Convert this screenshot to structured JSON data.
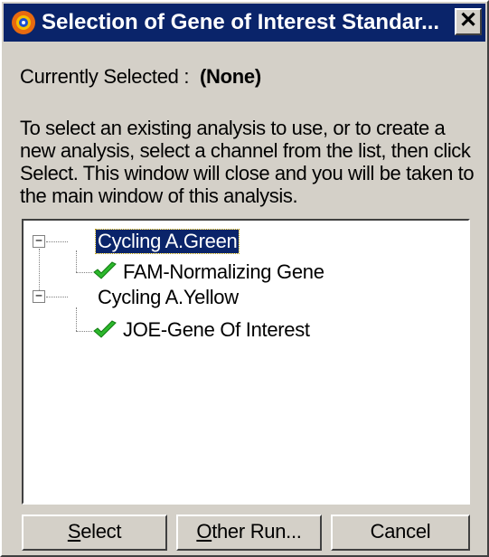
{
  "window": {
    "title": "Selection of Gene of Interest Standar...",
    "close_label": "✕"
  },
  "current": {
    "label": "Currently Selected :",
    "value": "(None)"
  },
  "instructions": "To select an existing analysis to use, or to create a new analysis, select a channel from the list, then click Select. This window will close and you will be taken to the main window of this analysis.",
  "tree": {
    "nodes": [
      {
        "label": "Cycling A.Green",
        "expander": "−",
        "selected": true,
        "children": [
          {
            "label": "FAM-Normalizing Gene",
            "icon": "checkmark-icon"
          }
        ]
      },
      {
        "label": "Cycling A.Yellow",
        "expander": "−",
        "selected": false,
        "children": [
          {
            "label": "JOE-Gene Of Interest",
            "icon": "checkmark-icon"
          }
        ]
      }
    ]
  },
  "buttons": {
    "select": {
      "mnemonic": "S",
      "rest": "elect"
    },
    "other_run": {
      "mnemonic": "O",
      "rest": "ther Run..."
    },
    "cancel": {
      "label": "Cancel"
    }
  },
  "colors": {
    "titlebar": "#0a246a",
    "window_face": "#d4d0c8",
    "selection": "#0a246a",
    "check": "#2db82d"
  }
}
